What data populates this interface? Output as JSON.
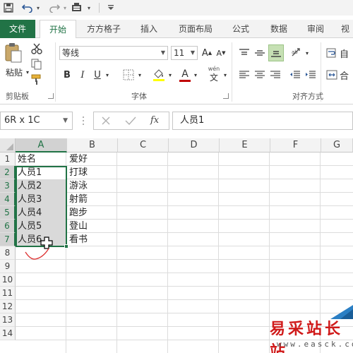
{
  "qat": {
    "redo_label": "Redo",
    "save_icon": "save-icon",
    "undo_icon": "undo-icon",
    "redo_icon": "redo-icon",
    "customize_icon": "customize-icon"
  },
  "tabs": [
    {
      "label": "文件"
    },
    {
      "label": "开始"
    },
    {
      "label": "方方格子"
    },
    {
      "label": "插入"
    },
    {
      "label": "页面布局"
    },
    {
      "label": "公式"
    },
    {
      "label": "数据"
    },
    {
      "label": "审阅"
    },
    {
      "label": "视"
    }
  ],
  "ribbon": {
    "clipboard": {
      "paste": "粘贴",
      "group": "剪贴板"
    },
    "font": {
      "name": "等线",
      "size": "11",
      "bold": "B",
      "italic": "I",
      "underline": "U",
      "grow": "A",
      "shrink": "A",
      "color": "A",
      "phonetic_top": "wén",
      "phonetic_bottom": "文",
      "group": "字体"
    },
    "align": {
      "wrap": "自",
      "merge": "合",
      "group": "对齐方式"
    }
  },
  "formula_bar": {
    "name_box": "6R x 1C",
    "fx": "fx",
    "content": "人员1"
  },
  "columns": [
    "A",
    "B",
    "C",
    "D",
    "E",
    "F",
    "G"
  ],
  "rows": [
    "1",
    "2",
    "3",
    "4",
    "5",
    "6",
    "7",
    "8",
    "9",
    "10",
    "11",
    "12",
    "13",
    "14"
  ],
  "cells": {
    "A": [
      "姓名",
      "人员1",
      "人员2",
      "人员3",
      "人员4",
      "人员5",
      "人员6"
    ],
    "B": [
      "爱好",
      "打球",
      "游泳",
      "射箭",
      "跑步",
      "登山",
      "看书"
    ]
  },
  "watermark": {
    "text": "易采站长站",
    "url": "www.easck.com"
  },
  "colors": {
    "accent": "#217346",
    "selection": "#d9d9d9",
    "watermark": "#d01a1a"
  }
}
